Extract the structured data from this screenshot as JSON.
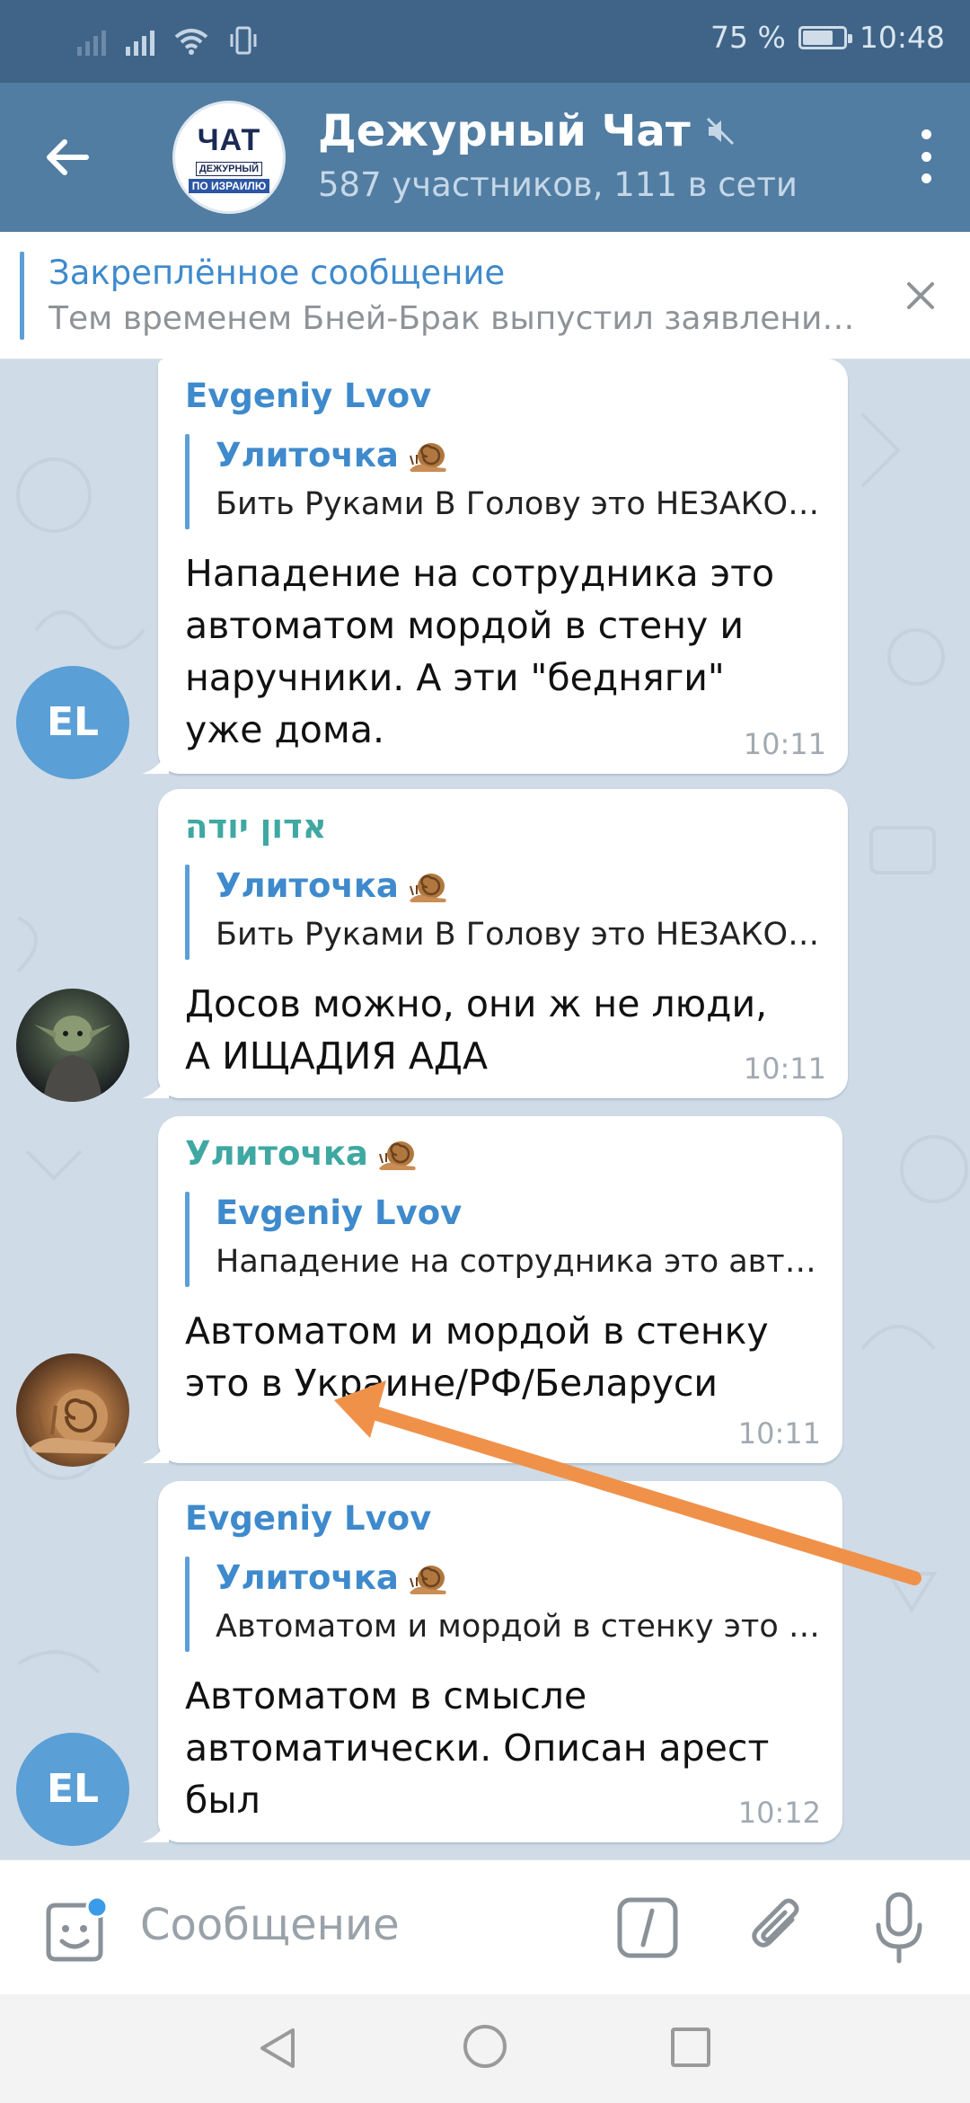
{
  "status_bar": {
    "battery": "75 %",
    "battery_level": 0.75,
    "time": "10:48"
  },
  "header": {
    "title": "Дежурный Чат",
    "subtitle": "587 участников, 111 в сети",
    "avatar_text": {
      "big": "ЧАТ",
      "line1": "ДЕЖУРНЫЙ",
      "line2": "ПО ИЗРАИЛЮ"
    },
    "muted": true
  },
  "pinned": {
    "title": "Закреплённое сообщение",
    "text": "Тем временем Бней-Брак выпустил заявление..."
  },
  "messages": [
    {
      "sender": "Evgeniy Lvov",
      "sender_color": "#3e8acc",
      "avatar": "EL",
      "reply_name": "Улиточка",
      "reply_emoji": "snail",
      "reply_text": "Бить Руками В Голову это НЕЗАКОННО",
      "text": "Нападение на сотрудника это\nавтоматом мордой в стену и\nнаручники. А эти \"бедняги\"\nуже дома.",
      "time": "10:11"
    },
    {
      "sender": "אדון יודה",
      "sender_color": "#3fa8a2",
      "avatar": "yoda-photo",
      "reply_name": "Улиточка",
      "reply_emoji": "snail",
      "reply_text": "Бить Руками В Голову это НЕЗАКОННО",
      "text": "Досов можно, они ж не люди,\nА ИЩАДИЯ АДА",
      "time": "10:11"
    },
    {
      "sender": "Улиточка",
      "sender_emoji": "snail",
      "sender_color": "#3fa8a2",
      "avatar": "snail-photo",
      "reply_name": "Evgeniy Lvov",
      "reply_text": "Нападение на сотрудника это автоматом",
      "text": "Автоматом и мордой в стенку\nэто в Украине/РФ/Беларуси",
      "time": "10:11"
    },
    {
      "sender": "Evgeniy Lvov",
      "sender_color": "#3e8acc",
      "avatar": "EL",
      "reply_name": "Улиточка",
      "reply_emoji": "snail",
      "reply_text": "Автоматом и мордой в стенку это в Украине",
      "text": "Автоматом в смысле\nавтоматически. Описан арест\nбыл",
      "time": "10:12"
    }
  ],
  "input": {
    "placeholder": "Сообщение"
  },
  "colors": {
    "header": "#517da2",
    "status_bar": "#3f6487",
    "accent": "#3e8acc",
    "annotation_arrow": "#f0914a"
  }
}
